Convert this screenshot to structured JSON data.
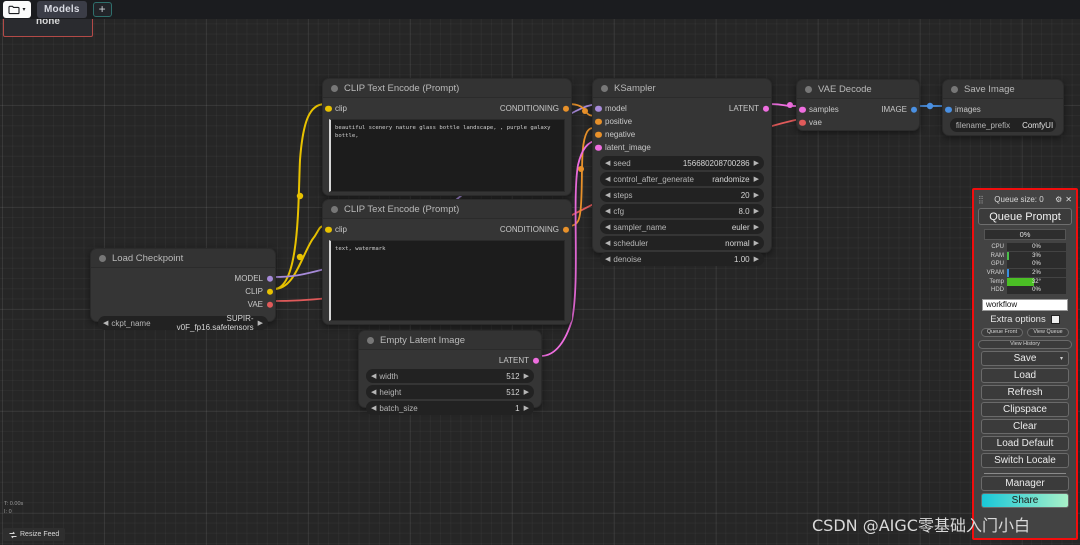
{
  "topbar": {
    "folder_icon": "folder-icon",
    "folder_caret": "▾",
    "tab_models": "Models",
    "add_tab": "+",
    "popup_text": "none"
  },
  "nodes": {
    "clip_positive": {
      "title": "CLIP Text Encode (Prompt)",
      "input_clip": "clip",
      "output_conditioning": "CONDITIONING",
      "text": "beautiful scenery nature glass bottle landscape, , purple galaxy bottle,"
    },
    "clip_negative": {
      "title": "CLIP Text Encode (Prompt)",
      "input_clip": "clip",
      "output_conditioning": "CONDITIONING",
      "text": "text, watermark"
    },
    "load_checkpoint": {
      "title": "Load Checkpoint",
      "outputs": [
        "MODEL",
        "CLIP",
        "VAE"
      ],
      "widget_name": "ckpt_name",
      "widget_value": "SUPIR-v0F_fp16.safetensors"
    },
    "ksampler": {
      "title": "KSampler",
      "inputs": [
        "model",
        "positive",
        "negative",
        "latent_image"
      ],
      "output": "LATENT",
      "widgets": [
        {
          "name": "seed",
          "value": "156680208700286"
        },
        {
          "name": "control_after_generate",
          "value": "randomize"
        },
        {
          "name": "steps",
          "value": "20"
        },
        {
          "name": "cfg",
          "value": "8.0"
        },
        {
          "name": "sampler_name",
          "value": "euler"
        },
        {
          "name": "scheduler",
          "value": "normal"
        },
        {
          "name": "denoise",
          "value": "1.00"
        }
      ]
    },
    "empty_latent": {
      "title": "Empty Latent Image",
      "output": "LATENT",
      "widgets": [
        {
          "name": "width",
          "value": "512"
        },
        {
          "name": "height",
          "value": "512"
        },
        {
          "name": "batch_size",
          "value": "1"
        }
      ]
    },
    "vae_decode": {
      "title": "VAE Decode",
      "inputs": [
        "samples",
        "vae"
      ],
      "output": "IMAGE"
    },
    "save_image": {
      "title": "Save Image",
      "input": "images",
      "widget_name": "filename_prefix",
      "widget_value": "ComfyUI"
    }
  },
  "queue_panel": {
    "grip": "⣿",
    "title": "Queue size: 0",
    "gear_icon": "⚙",
    "close_icon": "✕",
    "queue_prompt": "Queue Prompt",
    "progress": "0%",
    "monitor": [
      {
        "label": "CPU",
        "value": "0%",
        "pct": 0,
        "color": "#4bbf4b"
      },
      {
        "label": "RAM",
        "value": "3%",
        "pct": 4,
        "color": "#4bbf4b"
      },
      {
        "label": "GPU",
        "value": "0%",
        "pct": 0,
        "color": "#4bbf4b"
      },
      {
        "label": "VRAM",
        "value": "2%",
        "pct": 3,
        "color": "#3a8fe0"
      },
      {
        "label": "Temp",
        "value": "32°",
        "pct": 46,
        "color": "#4bbf25"
      },
      {
        "label": "HDD",
        "value": "0%",
        "pct": 0,
        "color": "#4bbf4b"
      }
    ],
    "workflow_value": "workflow",
    "extra_options": "Extra options",
    "queue_front": "Queue Front",
    "view_queue": "View Queue",
    "view_history": "View History",
    "save": "Save",
    "save_caret": "▾",
    "load": "Load",
    "refresh": "Refresh",
    "clipspace": "Clipspace",
    "clear": "Clear",
    "load_default": "Load Default",
    "switch_locale": "Switch Locale",
    "manager": "Manager",
    "share": "Share"
  },
  "status": {
    "time": "T: 0.00s",
    "iterations": "I: 0",
    "resize_feed": "Resize Feed",
    "resize_icon": "resize-icon"
  },
  "watermark": {
    "text": "CSDN @AIGC零基础入门小白"
  },
  "colors": {
    "accent_red": "#f20d0d",
    "link_clip": "#e8c200",
    "link_model": "#a78bda",
    "link_vae": "#e05a5a",
    "link_cond": "#e8912a",
    "link_latent": "#ef6ee0",
    "link_image": "#4a90e2"
  }
}
